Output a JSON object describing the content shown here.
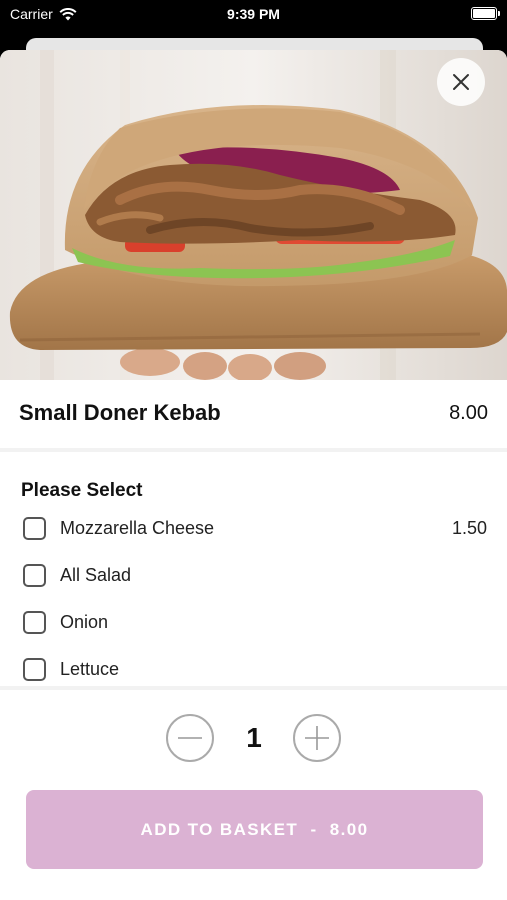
{
  "status_bar": {
    "carrier": "Carrier",
    "time": "9:39 PM"
  },
  "product": {
    "name": "Small Doner Kebab",
    "price": "8.00"
  },
  "options": {
    "title": "Please Select",
    "items": [
      {
        "label": "Mozzarella Cheese",
        "price": "1.50"
      },
      {
        "label": "All Salad",
        "price": ""
      },
      {
        "label": "Onion",
        "price": ""
      },
      {
        "label": "Lettuce",
        "price": ""
      }
    ]
  },
  "quantity": {
    "value": "1"
  },
  "add_button": {
    "label": "ADD TO BASKET  -  8.00"
  },
  "colors": {
    "accent": "#dbb2d3"
  }
}
